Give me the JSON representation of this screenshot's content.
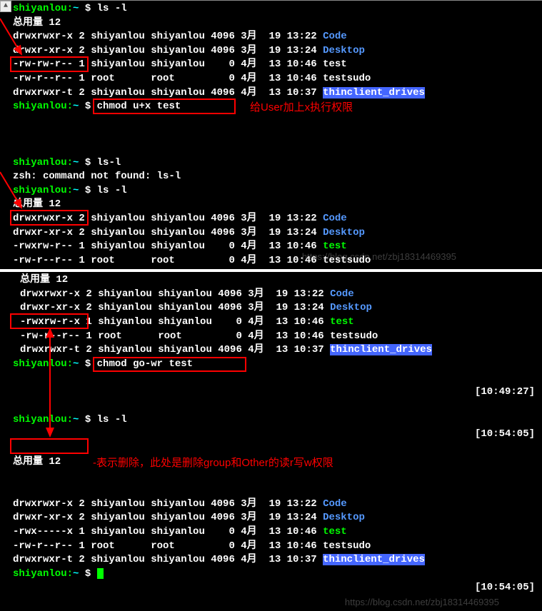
{
  "section1": {
    "prompt_user": "shiyanlou",
    "prompt_path": "~",
    "prompt_sep": ":",
    "prompt_dollar": "$",
    "cmd1": "ls -l",
    "total": "总用量 12",
    "rows": [
      {
        "perm": "drwxrwxr-x",
        "n": "2",
        "u": "shiyanlou",
        "g": "shiyanlou",
        "size": "4096",
        "mon": "3月",
        "day": "19",
        "time": "13:22",
        "name": "Code",
        "style": "blue"
      },
      {
        "perm": "drwxr-xr-x",
        "n": "2",
        "u": "shiyanlou",
        "g": "shiyanlou",
        "size": "4096",
        "mon": "3月",
        "day": "19",
        "time": "13:24",
        "name": "Desktop",
        "style": "blue"
      },
      {
        "perm": "-rw-rw-r--",
        "n": "1",
        "u": "shiyanlou",
        "g": "shiyanlou",
        "size": "0",
        "mon": "4月",
        "day": "13",
        "time": "10:46",
        "name": "test",
        "style": "white"
      },
      {
        "perm": "-rw-r--r--",
        "n": "1",
        "u": "root",
        "g": "root",
        "size": "0",
        "mon": "4月",
        "day": "13",
        "time": "10:46",
        "name": "testsudo",
        "style": "white"
      },
      {
        "perm": "drwxrwxr-t",
        "n": "2",
        "u": "shiyanlou",
        "g": "shiyanlou",
        "size": "4096",
        "mon": "4月",
        "day": "13",
        "time": "10:37",
        "name": "thinclient_drives",
        "style": "bg-blue"
      }
    ],
    "cmd2": "chmod u+x test",
    "cmd3": "ls-l",
    "err": "zsh: command not found: ls-l",
    "cmd4": "ls -l",
    "annotation1": "给User加上x执行权限",
    "total2": "总用量 12",
    "rows2": [
      {
        "perm": "drwxrwxr-x",
        "n": "2",
        "u": "shiyanlou",
        "g": "shiyanlou",
        "size": "4096",
        "mon": "3月",
        "day": "19",
        "time": "13:22",
        "name": "Code",
        "style": "blue"
      },
      {
        "perm": "drwxr-xr-x",
        "n": "2",
        "u": "shiyanlou",
        "g": "shiyanlou",
        "size": "4096",
        "mon": "3月",
        "day": "19",
        "time": "13:24",
        "name": "Desktop",
        "style": "blue"
      },
      {
        "perm": "-rwxrw-r--",
        "n": "1",
        "u": "shiyanlou",
        "g": "shiyanlou",
        "size": "0",
        "mon": "4月",
        "day": "13",
        "time": "10:46",
        "name": "test",
        "style": "green"
      },
      {
        "perm": "-rw-r--r--",
        "n": "1",
        "u": "root",
        "g": "root",
        "size": "0",
        "mon": "4月",
        "day": "13",
        "time": "10:46",
        "name": "testsudo",
        "style": "white"
      }
    ],
    "watermark1": "https://blog.csdn.net/zbj18314469395"
  },
  "section2": {
    "total": "总用量 12",
    "rows": [
      {
        "perm": "drwxrwxr-x",
        "n": "2",
        "u": "shiyanlou",
        "g": "shiyanlou",
        "size": "4096",
        "mon": "3月",
        "day": "19",
        "time": "13:22",
        "name": "Code",
        "style": "blue"
      },
      {
        "perm": "drwxr-xr-x",
        "n": "2",
        "u": "shiyanlou",
        "g": "shiyanlou",
        "size": "4096",
        "mon": "3月",
        "day": "19",
        "time": "13:24",
        "name": "Desktop",
        "style": "blue"
      },
      {
        "perm": "-rwxrw-r-x",
        "n": "1",
        "u": "shiyanlou",
        "g": "shiyanlou",
        "size": "0",
        "mon": "4月",
        "day": "13",
        "time": "10:46",
        "name": "test",
        "style": "green"
      },
      {
        "perm": "-rw-r--r--",
        "n": "1",
        "u": "root",
        "g": "root",
        "size": "0",
        "mon": "4月",
        "day": "13",
        "time": "10:46",
        "name": "testsudo",
        "style": "white"
      },
      {
        "perm": "drwxrwxr-t",
        "n": "2",
        "u": "shiyanlou",
        "g": "shiyanlou",
        "size": "4096",
        "mon": "4月",
        "day": "13",
        "time": "10:37",
        "name": "thinclient_drives",
        "style": "bg-blue"
      }
    ],
    "cmd1": "chmod go-wr test",
    "ts1": "[10:49:27]",
    "cmd2": "ls -l",
    "ts2": "[10:54:05]",
    "total2": "总用量 12",
    "annotation2": "-表示删除，此处是删除group和Other的读r写w权限",
    "rows2": [
      {
        "perm": "drwxrwxr-x",
        "n": "2",
        "u": "shiyanlou",
        "g": "shiyanlou",
        "size": "4096",
        "mon": "3月",
        "day": "19",
        "time": "13:22",
        "name": "Code",
        "style": "blue"
      },
      {
        "perm": "drwxr-xr-x",
        "n": "2",
        "u": "shiyanlou",
        "g": "shiyanlou",
        "size": "4096",
        "mon": "3月",
        "day": "19",
        "time": "13:24",
        "name": "Desktop",
        "style": "blue"
      },
      {
        "perm": "-rwx-----x",
        "n": "1",
        "u": "shiyanlou",
        "g": "shiyanlou",
        "size": "0",
        "mon": "4月",
        "day": "13",
        "time": "10:46",
        "name": "test",
        "style": "green"
      },
      {
        "perm": "-rw-r--r--",
        "n": "1",
        "u": "root",
        "g": "root",
        "size": "0",
        "mon": "4月",
        "day": "13",
        "time": "10:46",
        "name": "testsudo",
        "style": "white"
      },
      {
        "perm": "drwxrwxr-t",
        "n": "2",
        "u": "shiyanlou",
        "g": "shiyanlou",
        "size": "4096",
        "mon": "4月",
        "day": "13",
        "time": "10:37",
        "name": "thinclient_drives",
        "style": "bg-blue"
      }
    ],
    "ts3": "[10:54:05]",
    "watermark2": "https://blog.csdn.net/zbj18314469395"
  }
}
